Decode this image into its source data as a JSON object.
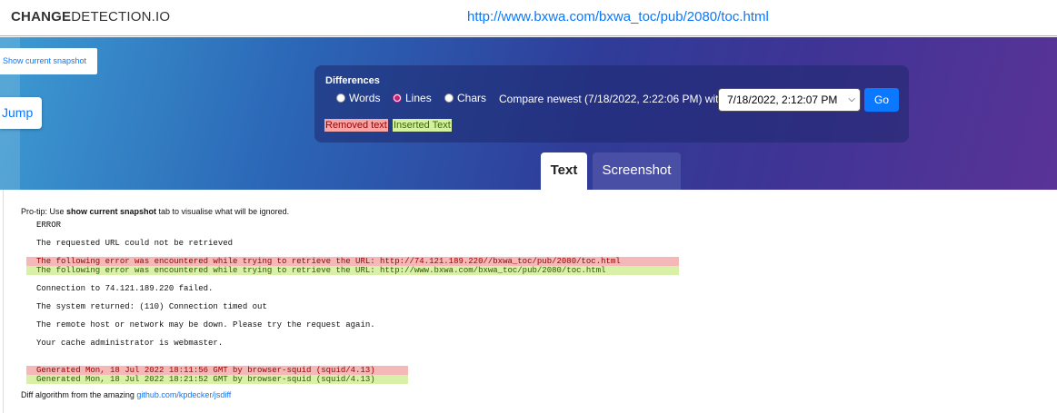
{
  "header": {
    "brand_bold": "CHANGE",
    "brand_regular": "DETECTION.IO",
    "url": "http://www.bxwa.com/bxwa_toc/pub/2080/toc.html"
  },
  "buttons": {
    "show_snapshot": "Show current snapshot",
    "jump": "Jump"
  },
  "differences": {
    "title": "Differences",
    "options": [
      {
        "label": "Words",
        "selected": false
      },
      {
        "label": "Lines",
        "selected": true
      },
      {
        "label": "Chars",
        "selected": false
      }
    ],
    "compare_text": "Compare newest (7/18/2022, 2:22:06 PM) with",
    "selected_date": "7/18/2022, 2:12:07 PM",
    "go_label": "Go",
    "legend_removed": "Removed text",
    "legend_inserted": "Inserted Text"
  },
  "tabs": [
    {
      "label": "Text",
      "active": true
    },
    {
      "label": "Screenshot",
      "active": false
    }
  ],
  "content": {
    "protip_prefix": "Pro-tip: Use ",
    "protip_bold": "show current snapshot",
    "protip_suffix": " tab to visualise what will be ignored.",
    "lines": [
      {
        "text": "ERROR",
        "type": "normal"
      },
      {
        "text": "The requested URL could not be retrieved",
        "type": "normal"
      },
      {
        "text": "The following error was encountered while trying to retrieve the URL: http://74.121.189.220//bxwa_toc/pub/2080/toc.html",
        "type": "removed"
      },
      {
        "text": "The following error was encountered while trying to retrieve the URL: http://www.bxwa.com/bxwa_toc/pub/2080/toc.html",
        "type": "inserted"
      },
      {
        "text": "Connection to 74.121.189.220 failed.",
        "type": "normal"
      },
      {
        "text": "The system returned: (110) Connection timed out",
        "type": "normal"
      },
      {
        "text": "The remote host or network may be down. Please try the request again.",
        "type": "normal"
      },
      {
        "text": "Your cache administrator is webmaster.",
        "type": "normal"
      },
      {
        "text": "Generated Mon, 18 Jul 2022 18:11:56 GMT by browser-squid (squid/4.13)",
        "type": "removed"
      },
      {
        "text": "Generated Mon, 18 Jul 2022 18:21:52 GMT by browser-squid (squid/4.13)",
        "type": "inserted"
      }
    ],
    "footer_prefix": "Diff algorithm from the amazing ",
    "footer_link": "github.com/kpdecker/jsdiff"
  },
  "colors": {
    "accent": "#0a78ff",
    "removed_bg": "#f5b8b8",
    "inserted_bg": "#d8f0a8"
  }
}
